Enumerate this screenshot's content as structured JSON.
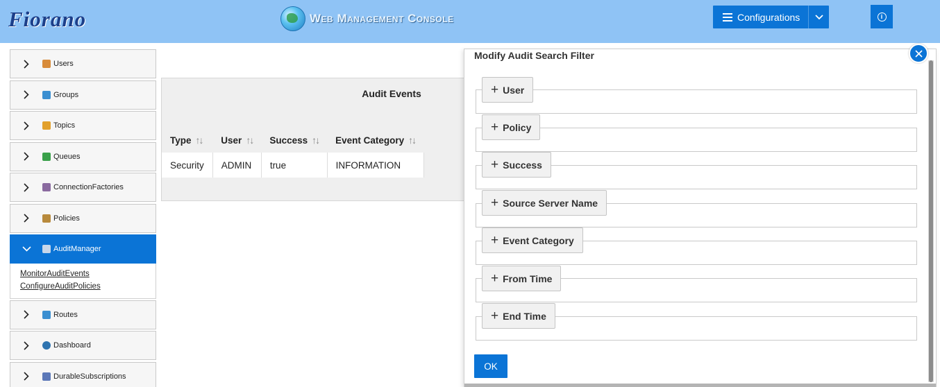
{
  "header": {
    "logo_text": "Fiorano",
    "console_title": "Web Management Console",
    "config_label": "Configurations",
    "info_icon": "info-icon"
  },
  "sidebar": {
    "items": [
      {
        "label": "Users",
        "icon": "users-icon",
        "color": "#d88b3a"
      },
      {
        "label": "Groups",
        "icon": "groups-icon",
        "color": "#3b8fd1"
      },
      {
        "label": "Topics",
        "icon": "topics-icon",
        "color": "#e2a02b"
      },
      {
        "label": "Queues",
        "icon": "queues-icon",
        "color": "#3aa04a"
      },
      {
        "label": "ConnectionFactories",
        "icon": "connection-factories-icon",
        "color": "#8a6a9f"
      },
      {
        "label": "Policies",
        "icon": "policies-icon",
        "color": "#b88a3c"
      },
      {
        "label": "AuditManager",
        "icon": "audit-manager-icon",
        "color": "#c9d7ea"
      },
      {
        "label": "Routes",
        "icon": "routes-icon",
        "color": "#3b8fd1"
      },
      {
        "label": "Dashboard",
        "icon": "dashboard-icon",
        "color": "#2f74b0"
      },
      {
        "label": "DurableSubscriptions",
        "icon": "durable-subscriptions-icon",
        "color": "#5c78b8"
      }
    ],
    "submenu": [
      "MonitorAuditEvents",
      "ConfigureAuditPolicies"
    ]
  },
  "audit": {
    "title": "Audit Events",
    "columns": [
      "Type",
      "User",
      "Success",
      "Event Category"
    ],
    "rows": [
      [
        "Security",
        "ADMIN",
        "true",
        "INFORMATION"
      ]
    ]
  },
  "modal": {
    "title": "Modify Audit Search Filter",
    "fields": [
      "User",
      "Policy",
      "Success",
      "Source Server Name",
      "Event Category",
      "From Time",
      "End Time"
    ],
    "ok_label": "OK"
  },
  "colors": {
    "header_bg": "#8fc3f5",
    "accent": "#0b74d6"
  }
}
